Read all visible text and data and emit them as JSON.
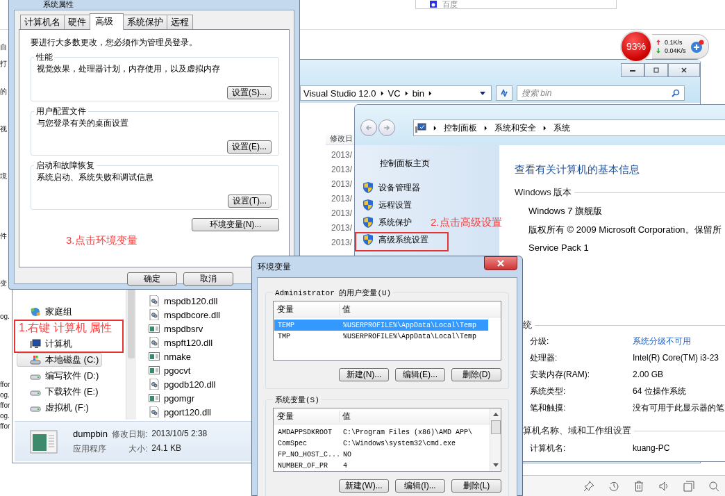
{
  "background_page": {
    "search_text": "百度",
    "edge_fragments": [
      "自",
      "打",
      "的",
      "视",
      "境",
      "件",
      "变",
      "og.",
      "ffor",
      "og.",
      "ffor",
      "og.",
      "ffor"
    ]
  },
  "explorer": {
    "path": [
      "Visual Studio 12.0",
      "VC",
      "bin"
    ],
    "search_placeholder": "搜索 bin",
    "date_header": "修改日",
    "dates": [
      "2013/",
      "2013/",
      "2013/",
      "2013/",
      "2013/",
      "2013/",
      "2013/"
    ],
    "nav": [
      {
        "label": "家庭组",
        "kind": "homegroup",
        "selected": false
      },
      {
        "label": "计算机",
        "kind": "computer",
        "selected": false
      },
      {
        "label": "本地磁盘 (C:)",
        "kind": "system-drive",
        "selected": true
      },
      {
        "label": "编写软件 (D:)",
        "kind": "drive",
        "selected": false
      },
      {
        "label": "下载软件 (E:)",
        "kind": "drive",
        "selected": false
      },
      {
        "label": "虚拟机 (F:)",
        "kind": "drive",
        "selected": false
      }
    ],
    "files": [
      {
        "name": "mspdb120.dll",
        "kind": "dll"
      },
      {
        "name": "mspdbcore.dll",
        "kind": "dll"
      },
      {
        "name": "mspdbsrv",
        "kind": "exe"
      },
      {
        "name": "mspft120.dll",
        "kind": "dll"
      },
      {
        "name": "nmake",
        "kind": "exe"
      },
      {
        "name": "pgocvt",
        "kind": "exe"
      },
      {
        "name": "pgodb120.dll",
        "kind": "dll"
      },
      {
        "name": "pgomgr",
        "kind": "exe"
      },
      {
        "name": "pgort120.dll",
        "kind": "dll"
      }
    ],
    "details": {
      "name": "dumpbin",
      "modified_label": "修改日期:",
      "modified": "2013/10/5 2:38",
      "type": "应用程序",
      "size_label": "大小:",
      "size": "24.1 KB"
    }
  },
  "network_widget": {
    "load": "93%",
    "upload": "0.1K/s",
    "download": "0.04K/s"
  },
  "system_properties": {
    "title": "系统属性",
    "tabs": [
      {
        "label": "计算机名",
        "selected": false
      },
      {
        "label": "硬件",
        "selected": false
      },
      {
        "label": "高级",
        "selected": true
      },
      {
        "label": "系统保护",
        "selected": false
      },
      {
        "label": "远程",
        "selected": false
      }
    ],
    "notice": "要进行大多数更改，您必须作为管理员登录。",
    "groups": [
      {
        "title": "性能",
        "description": "视觉效果，处理器计划，内存使用，以及虚拟内存",
        "button": "设置(S)..."
      },
      {
        "title": "用户配置文件",
        "description": "与您登录有关的桌面设置",
        "button": "设置(E)..."
      },
      {
        "title": "启动和故障恢复",
        "description": "系统启动、系统失败和调试信息",
        "button": "设置(T)..."
      }
    ],
    "env_button": "环境变量(N)...",
    "buttons": [
      "确定",
      "取消"
    ]
  },
  "control_panel": {
    "breadcrumb": [
      "控制面板",
      "系统和安全",
      "系统"
    ],
    "home_link": "控制面板主页",
    "links": [
      "设备管理器",
      "远程设置",
      "系统保护",
      "高级系统设置"
    ],
    "heading": "查看有关计算机的基本信息",
    "edition_section": "Windows 版本",
    "edition_lines": [
      "Windows 7 旗舰版",
      "版权所有 © 2009 Microsoft Corporation。保留所",
      "Service Pack 1"
    ],
    "system_section": "统",
    "system_rows": [
      {
        "label": "分级:",
        "value": "系统分级不可用",
        "kind": "link"
      },
      {
        "label": "处理器:",
        "value": "Intel(R) Core(TM) i3-23",
        "kind": "text"
      },
      {
        "label": "安装内存(RAM):",
        "value": "2.00 GB",
        "kind": "text"
      },
      {
        "label": "系统类型:",
        "value": "64 位操作系统",
        "kind": "text"
      },
      {
        "label": "笔和触摸:",
        "value": "没有可用于此显示器的笔",
        "kind": "text"
      }
    ],
    "name_section": "算机名称、域和工作组设置",
    "name_rows": [
      {
        "label": "计算机名:",
        "value": "kuang-PC",
        "kind": "text"
      }
    ]
  },
  "env_vars": {
    "title": "环境变量",
    "user_group": "Administrator 的用户变量(U)",
    "user_columns": [
      "变量",
      "值"
    ],
    "system_columns": [
      "变量",
      "值"
    ],
    "user_vars": [
      {
        "name": "TEMP",
        "value": "%USERPROFILE%\\AppData\\Local\\Temp",
        "selected": true
      },
      {
        "name": "TMP",
        "value": "%USERPROFILE%\\AppData\\Local\\Temp",
        "selected": false
      }
    ],
    "user_buttons": [
      "新建(N)...",
      "编辑(E)...",
      "删除(D)"
    ],
    "system_group": "系统变量(S)",
    "system_vars": [
      {
        "name": "AMDAPPSDKROOT",
        "value": "C:\\Program Files (x86)\\AMD APP\\"
      },
      {
        "name": "ComSpec",
        "value": "C:\\Windows\\system32\\cmd.exe"
      },
      {
        "name": "FP_NO_HOST_C...",
        "value": "NO"
      },
      {
        "name": "NUMBER_OF_PR",
        "value": "4"
      }
    ],
    "system_buttons": [
      "新建(W)...",
      "编辑(I)...",
      "删除(L)"
    ]
  },
  "steps": [
    {
      "text": "1.右键 计算机 属性"
    },
    {
      "text": "2.点击高级设置"
    },
    {
      "text": "3.点击环境变量"
    }
  ]
}
